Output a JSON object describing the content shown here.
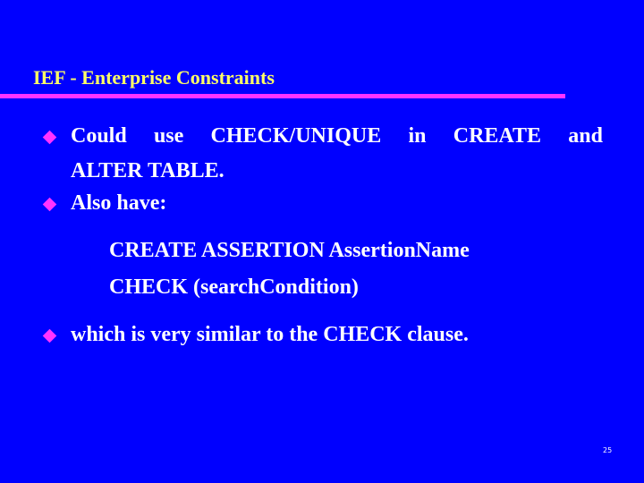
{
  "slide": {
    "title": "IEF - Enterprise Constraints",
    "bullets": [
      {
        "line1_words": [
          "Could",
          "use",
          "CHECK/UNIQUE",
          "in",
          "CREATE",
          "and"
        ],
        "line2": "ALTER TABLE."
      },
      {
        "text": "Also have:"
      }
    ],
    "code_lines": [
      "CREATE ASSERTION AssertionName",
      "CHECK (searchCondition)"
    ],
    "closing_bullet": "which is very similar to the CHECK clause.",
    "page_number": "25"
  },
  "colors": {
    "background": "#0000ff",
    "title": "#ffff66",
    "accent": "#ff33ff",
    "text": "#ffffff"
  }
}
